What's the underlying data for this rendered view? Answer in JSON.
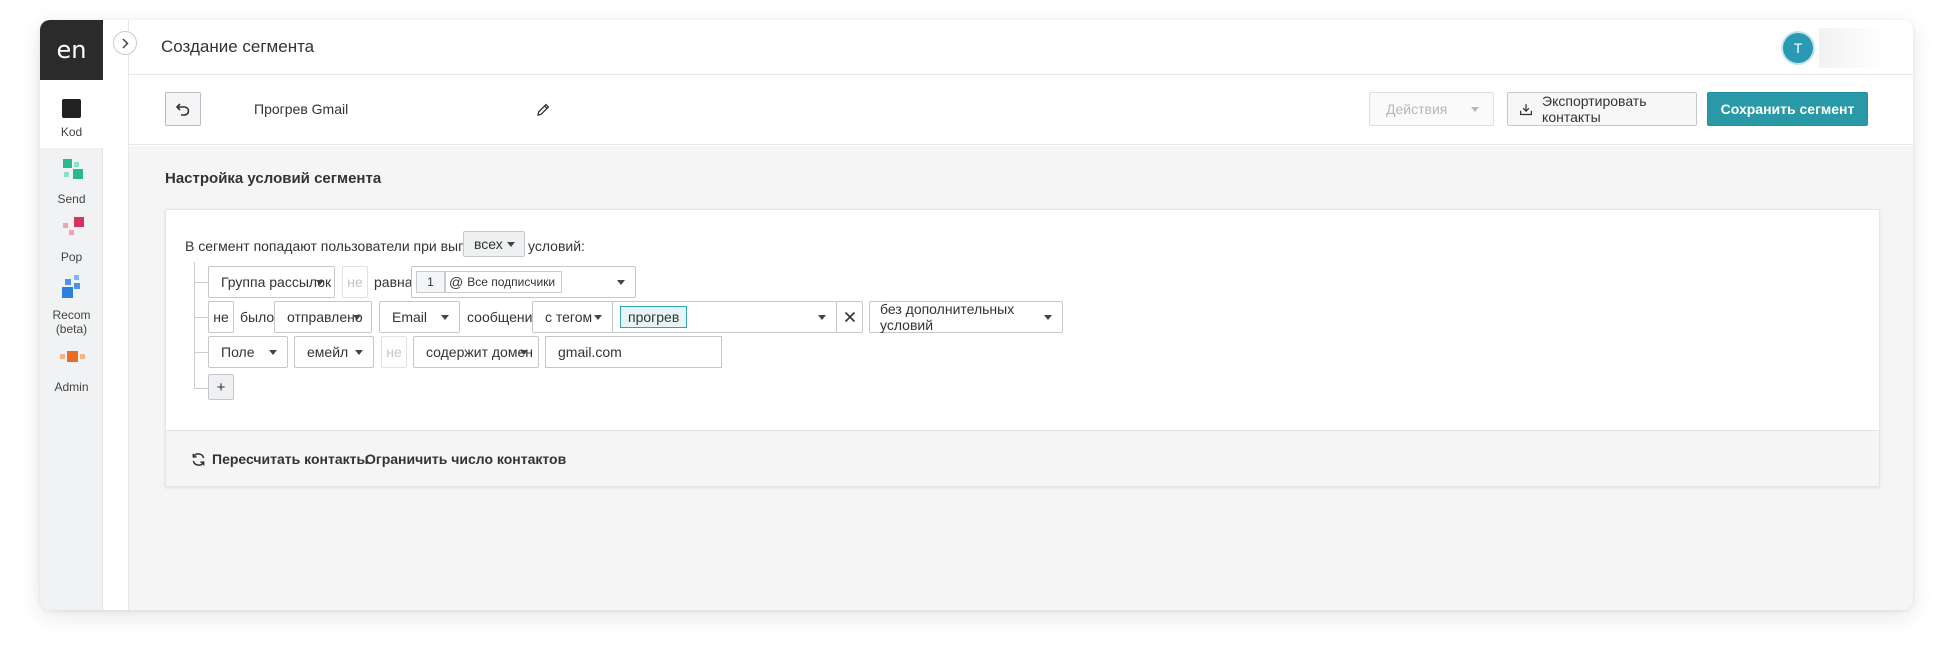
{
  "logo": "en",
  "sidebar": {
    "items": [
      {
        "label": "Kod",
        "icon": "kod-square-icon",
        "active": true
      },
      {
        "label": "Send",
        "icon": "send-blocks-icon"
      },
      {
        "label": "Pop",
        "icon": "pop-blocks-icon"
      },
      {
        "label": "Recom (beta)",
        "icon": "recom-blocks-icon"
      },
      {
        "label": "Admin",
        "icon": "admin-blocks-icon"
      }
    ]
  },
  "header": {
    "title": "Создание сегмента",
    "avatar_initial": "T"
  },
  "toolbar": {
    "segment_name": "Прогрев Gmail",
    "actions_label": "Действия",
    "export_label": "Экспортировать контакты",
    "save_label": "Сохранить сегмент"
  },
  "conditions": {
    "section_title": "Настройка условий сегмента",
    "intro_text": "В сегмент попадают пользователи при выполнении",
    "match_mode": "всех",
    "intro_suffix": "условий:",
    "row1": {
      "field": "Группа рассылок",
      "negation": "не",
      "operator": "равна",
      "group_id": "1",
      "group_name": "Все подписчики"
    },
    "row2": {
      "negation": "не",
      "verb": "было",
      "action": "отправлено",
      "channel": "Email",
      "noun": "сообщение",
      "filter": "с тегом",
      "tag": "прогрев",
      "extra": "без дополнительных условий"
    },
    "row3": {
      "field_type": "Поле",
      "field_name": "емейл",
      "negation": "не",
      "operator": "содержит домен",
      "value": "gmail.com"
    },
    "add_label": "+"
  },
  "footer": {
    "recount_label": "Пересчитать контакты",
    "limit_label": "Ограничить число контактов"
  },
  "colors": {
    "primary": "#2a99a7",
    "avatar": "#2a9ab4",
    "logo_bg": "#2b2b2b"
  }
}
